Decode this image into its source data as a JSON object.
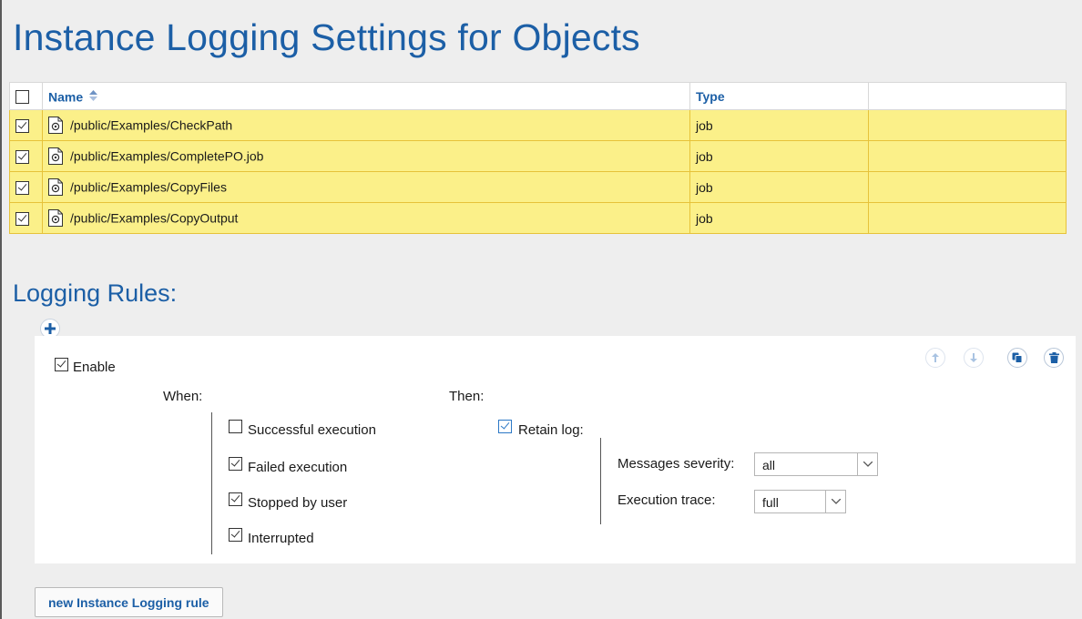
{
  "page": {
    "title": "Instance Logging Settings for Objects"
  },
  "objects_table": {
    "columns": [
      "Name",
      "Type",
      ""
    ],
    "header_checkbox_checked": false,
    "sort": {
      "column": "Name",
      "icon": "sort-icon"
    },
    "rows": [
      {
        "checked": true,
        "icon": "job-file-icon",
        "name": "/public/Examples/CheckPath",
        "type": "job"
      },
      {
        "checked": true,
        "icon": "job-file-icon",
        "name": "/public/Examples/CompletePO.job",
        "type": "job"
      },
      {
        "checked": true,
        "icon": "job-file-icon",
        "name": "/public/Examples/CopyFiles",
        "type": "job"
      },
      {
        "checked": true,
        "icon": "job-file-icon",
        "name": "/public/Examples/CopyOutput",
        "type": "job"
      }
    ],
    "selected_row_color": "#fbf089"
  },
  "logging_rules": {
    "title": "Logging Rules:",
    "rule": {
      "enable_label": "Enable",
      "enabled": true,
      "when_label": "When:",
      "then_label": "Then:",
      "conditions": [
        {
          "label": "Successful execution",
          "checked": false
        },
        {
          "label": "Failed execution",
          "checked": true
        },
        {
          "label": "Stopped by user",
          "checked": true
        },
        {
          "label": "Interrupted",
          "checked": true
        }
      ],
      "retain_log": {
        "label": "Retain log:",
        "checked": true
      },
      "messages_severity": {
        "label": "Messages severity:",
        "value": "all"
      },
      "execution_trace": {
        "label": "Execution trace:",
        "value": "full"
      }
    }
  },
  "buttons": {
    "new_rule": "new Instance Logging rule"
  },
  "colors": {
    "accent": "#1c5fa6",
    "checkbox_blue": "#2b78c6",
    "background": "#eeeeee"
  }
}
